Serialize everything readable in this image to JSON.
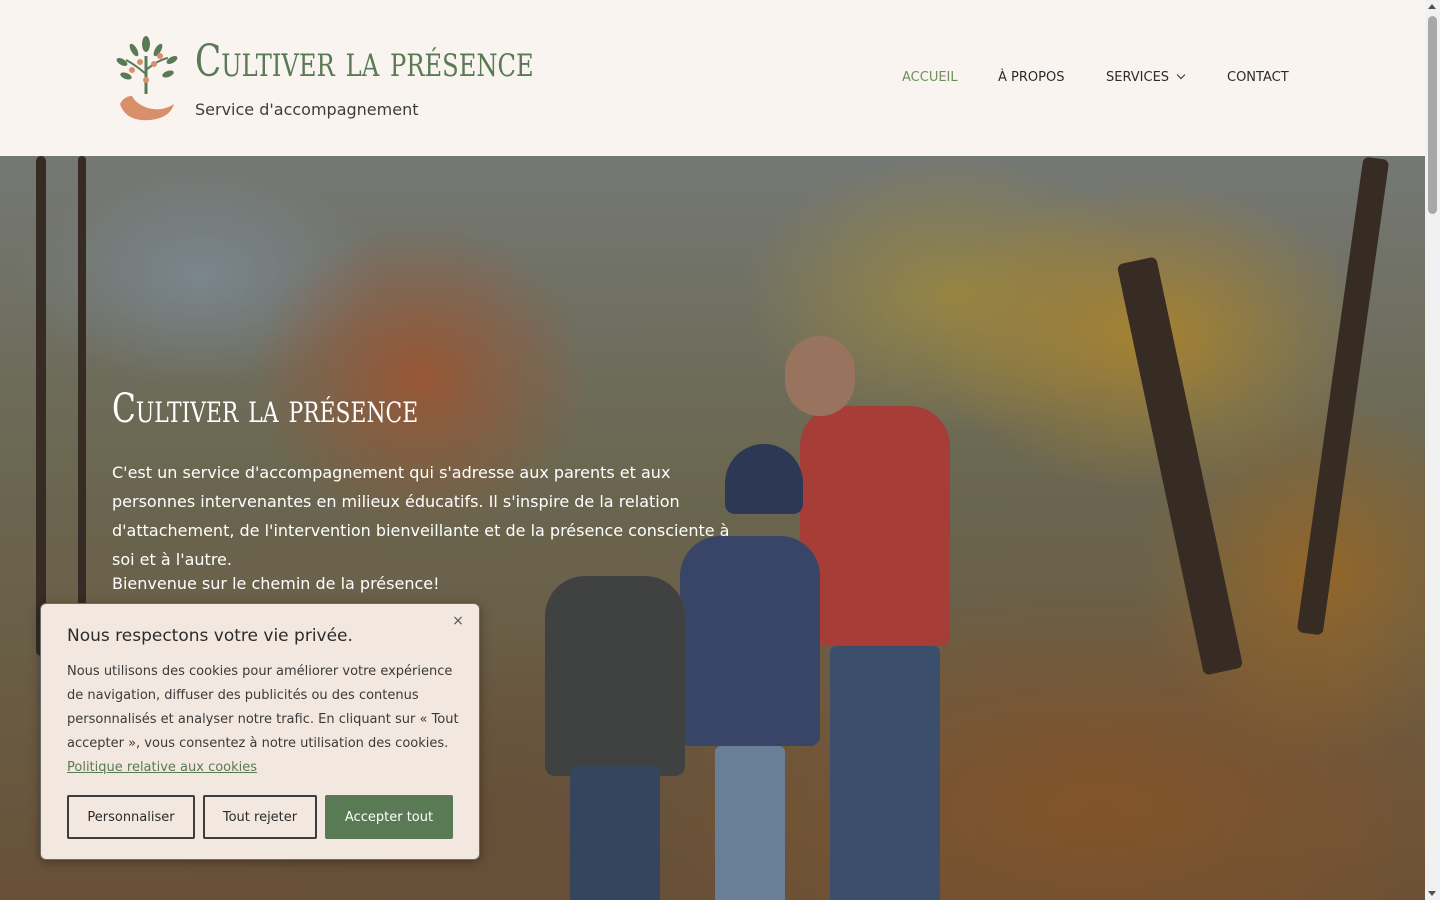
{
  "header": {
    "site_title": "Cultiver la présence",
    "tagline": "Service d'accompagnement",
    "logo_icon": "tree-hand-logo-icon"
  },
  "nav": {
    "items": [
      {
        "label": "ACCUEIL",
        "active": true
      },
      {
        "label": "À PROPOS",
        "active": false
      },
      {
        "label": "SERVICES",
        "active": false,
        "has_dropdown": true
      },
      {
        "label": "CONTACT",
        "active": false
      }
    ]
  },
  "hero": {
    "title": "Cultiver la présence",
    "text": "C'est un service d'accompagnement qui s'adresse aux parents et aux personnes intervenantes en milieux éducatifs. Il s'inspire de la relation d'attachement, de l'intervention bienveillante et de la présence consciente à soi et à l'autre.",
    "welcome": "Bienvenue sur le chemin de la présence!"
  },
  "cookie": {
    "title": "Nous respectons votre vie privée.",
    "text": "Nous utilisons des cookies pour améliorer votre expérience de navigation, diffuser des publicités ou des contenus personnalisés et analyser notre trafic. En cliquant sur « Tout accepter », vous consentez à notre utilisation des cookies.",
    "link": "Politique relative aux cookies",
    "close": "×",
    "btn_customize": "Personnaliser",
    "btn_reject": "Tout rejeter",
    "btn_accept": "Accepter tout"
  },
  "colors": {
    "brand_green": "#5a7a55",
    "nav_active": "#6f8f60",
    "header_bg": "#f9f4f0",
    "cookie_bg": "#f3e8df"
  }
}
